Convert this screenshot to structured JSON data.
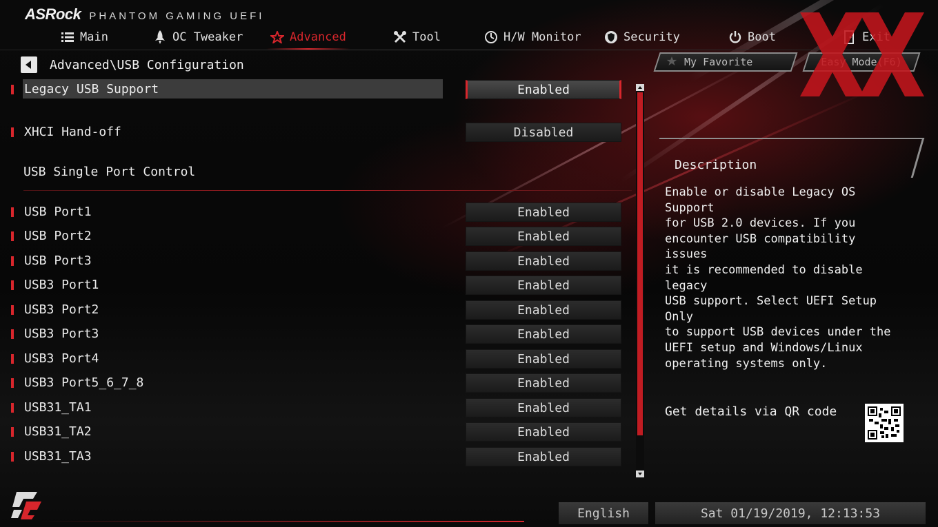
{
  "brand": {
    "logo": "ASRock",
    "subtitle": "PHANTOM GAMING UEFI"
  },
  "tabs": [
    {
      "label": "Main",
      "icon": "list-icon"
    },
    {
      "label": "OC Tweaker",
      "icon": "rocket-icon"
    },
    {
      "label": "Advanced",
      "icon": "star-icon",
      "active": true
    },
    {
      "label": "Tool",
      "icon": "tools-icon"
    },
    {
      "label": "H/W Monitor",
      "icon": "monitor-icon"
    },
    {
      "label": "Security",
      "icon": "shield-icon"
    },
    {
      "label": "Boot",
      "icon": "power-icon"
    },
    {
      "label": "Exit",
      "icon": "exit-icon"
    }
  ],
  "breadcrumb": "Advanced\\USB Configuration",
  "settings": [
    {
      "label": "Legacy USB Support",
      "value": "Enabled"
    },
    {
      "label": "XHCI Hand-off",
      "value": "Disabled"
    }
  ],
  "section_title": "USB Single Port Control",
  "ports": [
    {
      "label": "USB Port1",
      "value": "Enabled"
    },
    {
      "label": "USB Port2",
      "value": "Enabled"
    },
    {
      "label": "USB Port3",
      "value": "Enabled"
    },
    {
      "label": "USB3 Port1",
      "value": "Enabled"
    },
    {
      "label": "USB3 Port2",
      "value": "Enabled"
    },
    {
      "label": "USB3 Port3",
      "value": "Enabled"
    },
    {
      "label": "USB3 Port4",
      "value": "Enabled"
    },
    {
      "label": "USB3 Port5_6_7_8",
      "value": "Enabled"
    },
    {
      "label": "USB31_TA1",
      "value": "Enabled"
    },
    {
      "label": "USB31_TA2",
      "value": "Enabled"
    },
    {
      "label": "USB31_TA3",
      "value": "Enabled"
    }
  ],
  "right": {
    "favorite": "My Favorite",
    "easy_mode": "Easy Mode(F6)",
    "desc_title": "Description",
    "desc_text": "Enable or disable Legacy OS Support\nfor USB 2.0 devices. If you\nencounter USB compatibility issues\nit is recommended to disable legacy\nUSB support. Select UEFI Setup Only\nto support USB devices under the\nUEFI setup and Windows/Linux\noperating systems only.",
    "qr_label": "Get details via QR code"
  },
  "footer": {
    "language": "English",
    "datetime": "Sat 01/19/2019, 12:13:53"
  },
  "colors": {
    "accent": "#d8262c",
    "background": "#0a0a0a",
    "text": "#e6e6e6"
  }
}
